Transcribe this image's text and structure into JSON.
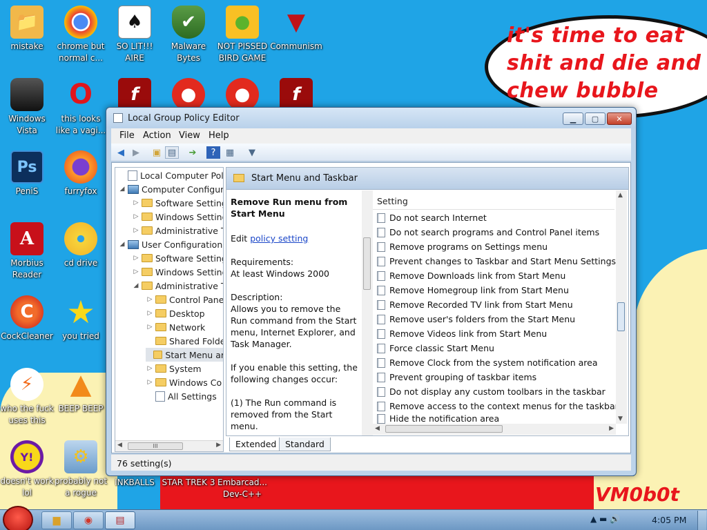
{
  "desktop": {
    "wallpaper_text": "it's time to eat shit and die and chew bubble gum",
    "signature": "VM0b0t",
    "icons": [
      {
        "label": "mistake",
        "glyph": "📁"
      },
      {
        "label": "chrome but normal c...",
        "glyph": "◉"
      },
      {
        "label": "SO LIT!!! AIRE",
        "glyph": "♠"
      },
      {
        "label": "Malware Bytes",
        "glyph": "✔"
      },
      {
        "label": "NOT PISSED BIRD GAME",
        "glyph": "●"
      },
      {
        "label": "Communism",
        "glyph": "▼"
      },
      {
        "label": "Windows Vista",
        "glyph": "▮"
      },
      {
        "label": "this looks like a vagi...",
        "glyph": "O"
      },
      {
        "label": "",
        "glyph": "f"
      },
      {
        "label": "",
        "glyph": "●"
      },
      {
        "label": "",
        "glyph": "●"
      },
      {
        "label": "",
        "glyph": "f"
      },
      {
        "label": "PeniS",
        "glyph": "Ps"
      },
      {
        "label": "furryfox",
        "glyph": "◍"
      },
      {
        "label": "Morbius Reader",
        "glyph": "A"
      },
      {
        "label": "cd drive",
        "glyph": "◎"
      },
      {
        "label": "CockCleaner",
        "glyph": "C"
      },
      {
        "label": "you tried",
        "glyph": "★"
      },
      {
        "label": "who the fuck uses this",
        "glyph": "⚡"
      },
      {
        "label": "BEEP BEEP",
        "glyph": "▲"
      },
      {
        "label": "doesn't work lol",
        "glyph": "Y!"
      },
      {
        "label": "probably not a rogue",
        "glyph": "⚙"
      },
      {
        "label": "INKBALLS",
        "glyph": ""
      },
      {
        "label": "STAR TREK 3",
        "glyph": ""
      },
      {
        "label": "Embarcad... Dev-C++",
        "glyph": ""
      }
    ]
  },
  "window": {
    "title": "Local Group Policy Editor",
    "menu": [
      "File",
      "Action",
      "View",
      "Help"
    ],
    "toolbar_icons": [
      "back-arrow-icon",
      "forward-arrow-icon",
      "up-folder-icon",
      "show-hide-tree-icon",
      "export-list-icon",
      "help-icon",
      "properties-icon",
      "filter-icon"
    ],
    "tree": [
      {
        "label": "Local Computer Policy",
        "level": 0,
        "exp": "",
        "icon": "doc"
      },
      {
        "label": "Computer Configura",
        "level": 1,
        "exp": "◢",
        "icon": "pc"
      },
      {
        "label": "Software Setting",
        "level": 2,
        "exp": "▷",
        "icon": "folder"
      },
      {
        "label": "Windows Setting",
        "level": 2,
        "exp": "▷",
        "icon": "folder"
      },
      {
        "label": "Administrative Te",
        "level": 2,
        "exp": "▷",
        "icon": "folder"
      },
      {
        "label": "User Configuration",
        "level": 1,
        "exp": "◢",
        "icon": "pc"
      },
      {
        "label": "Software Setting",
        "level": 2,
        "exp": "▷",
        "icon": "folder"
      },
      {
        "label": "Windows Setting",
        "level": 2,
        "exp": "▷",
        "icon": "folder"
      },
      {
        "label": "Administrative Te",
        "level": 2,
        "exp": "◢",
        "icon": "folder"
      },
      {
        "label": "Control Pane",
        "level": 3,
        "exp": "▷",
        "icon": "folder"
      },
      {
        "label": "Desktop",
        "level": 3,
        "exp": "▷",
        "icon": "folder"
      },
      {
        "label": "Network",
        "level": 3,
        "exp": "▷",
        "icon": "folder"
      },
      {
        "label": "Shared Folde",
        "level": 3,
        "exp": "",
        "icon": "folder"
      },
      {
        "label": "Start Menu ar",
        "level": 3,
        "exp": "",
        "icon": "folder",
        "selected": true
      },
      {
        "label": "System",
        "level": 3,
        "exp": "▷",
        "icon": "folder"
      },
      {
        "label": "Windows Co",
        "level": 3,
        "exp": "▷",
        "icon": "folder"
      },
      {
        "label": "All Settings",
        "level": 3,
        "exp": "",
        "icon": "doc"
      }
    ],
    "tree_scroll_thumb": "III",
    "pane_header": "Start Menu and Taskbar",
    "extended": {
      "title": "Remove Run menu from Start Menu",
      "edit_prefix": "Edit",
      "edit_link": "policy setting",
      "requirements_label": "Requirements:",
      "requirements_value": "At least Windows 2000",
      "description_label": "Description:",
      "description": "Allows you to remove the Run command from the Start menu, Internet Explorer, and Task Manager.",
      "enable_text": "If you enable this setting, the following changes occur:",
      "change_1": "(1) The Run command is removed from the Start menu."
    },
    "list_header": "Setting",
    "settings": [
      "Do not search Internet",
      "Do not search programs and Control Panel items",
      "Remove programs on Settings menu",
      "Prevent changes to Taskbar and Start Menu Settings",
      "Remove Downloads link from Start Menu",
      "Remove Homegroup link from Start Menu",
      "Remove Recorded TV link from Start Menu",
      "Remove user's folders from the Start Menu",
      "Remove Videos link from Start Menu",
      "Force classic Start Menu",
      "Remove Clock from the system notification area",
      "Prevent grouping of taskbar items",
      "Do not display any custom toolbars in the taskbar",
      "Remove access to the context menus for the taskbar",
      "Hide the notification area"
    ],
    "tabs": [
      "Extended",
      "Standard"
    ],
    "status": "76 setting(s)"
  },
  "taskbar": {
    "buttons": [
      "folder-icon",
      "chrome-icon",
      "group-policy-icon"
    ],
    "tray_icons": "▲ ▬ 🔊",
    "clock": "4:05 PM"
  },
  "colors": {
    "desktop_blue": "#1fa4e6",
    "wallpaper_red": "#e8161c",
    "wallpaper_yellow": "#fbf2b4",
    "link_blue": "#1a46c8"
  }
}
